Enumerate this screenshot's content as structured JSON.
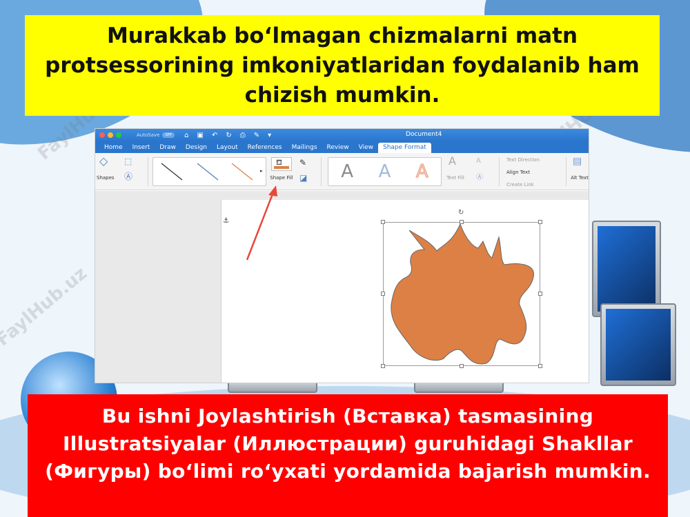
{
  "slide": {
    "title_text": "Murakkab bo‘lmagan chizmalarni matn protsessorining imkoniyatlaridan foydalanib ham chizish mumkin.",
    "bottom_text": "Bu ishni Joylashtirish (Вставка) tasmasining Illustratsiyalar (Иллюстрации) guruhidagi Shakllar (Фигуры) bo‘limi ro‘yxati yordamida bajarish mumkin.",
    "watermark": "FaylHub.uz"
  },
  "word": {
    "autosave_label": "AutoSave",
    "autosave_state": "OFF",
    "document_title": "Document4",
    "tabs": [
      {
        "label": "Home"
      },
      {
        "label": "Insert"
      },
      {
        "label": "Draw"
      },
      {
        "label": "Design"
      },
      {
        "label": "Layout"
      },
      {
        "label": "References"
      },
      {
        "label": "Mailings"
      },
      {
        "label": "Review"
      },
      {
        "label": "View"
      },
      {
        "label": "Shape Format"
      }
    ],
    "active_tab": "Shape Format",
    "ribbon": {
      "shapes_label": "Shapes",
      "shape_fill_label": "Shape Fill",
      "text_fill_label": "Text Fill",
      "text_direction_label": "Text Direction",
      "align_text_label": "Align Text",
      "create_link_label": "Create Link",
      "alt_text_label": "Alt Text"
    },
    "shape_color": "#dd8045",
    "accent_color": "#2a76cc",
    "arrow_color": "#e8473a"
  },
  "colors": {
    "title_bg": "#ffff00",
    "bottom_bg": "#ff0000"
  }
}
